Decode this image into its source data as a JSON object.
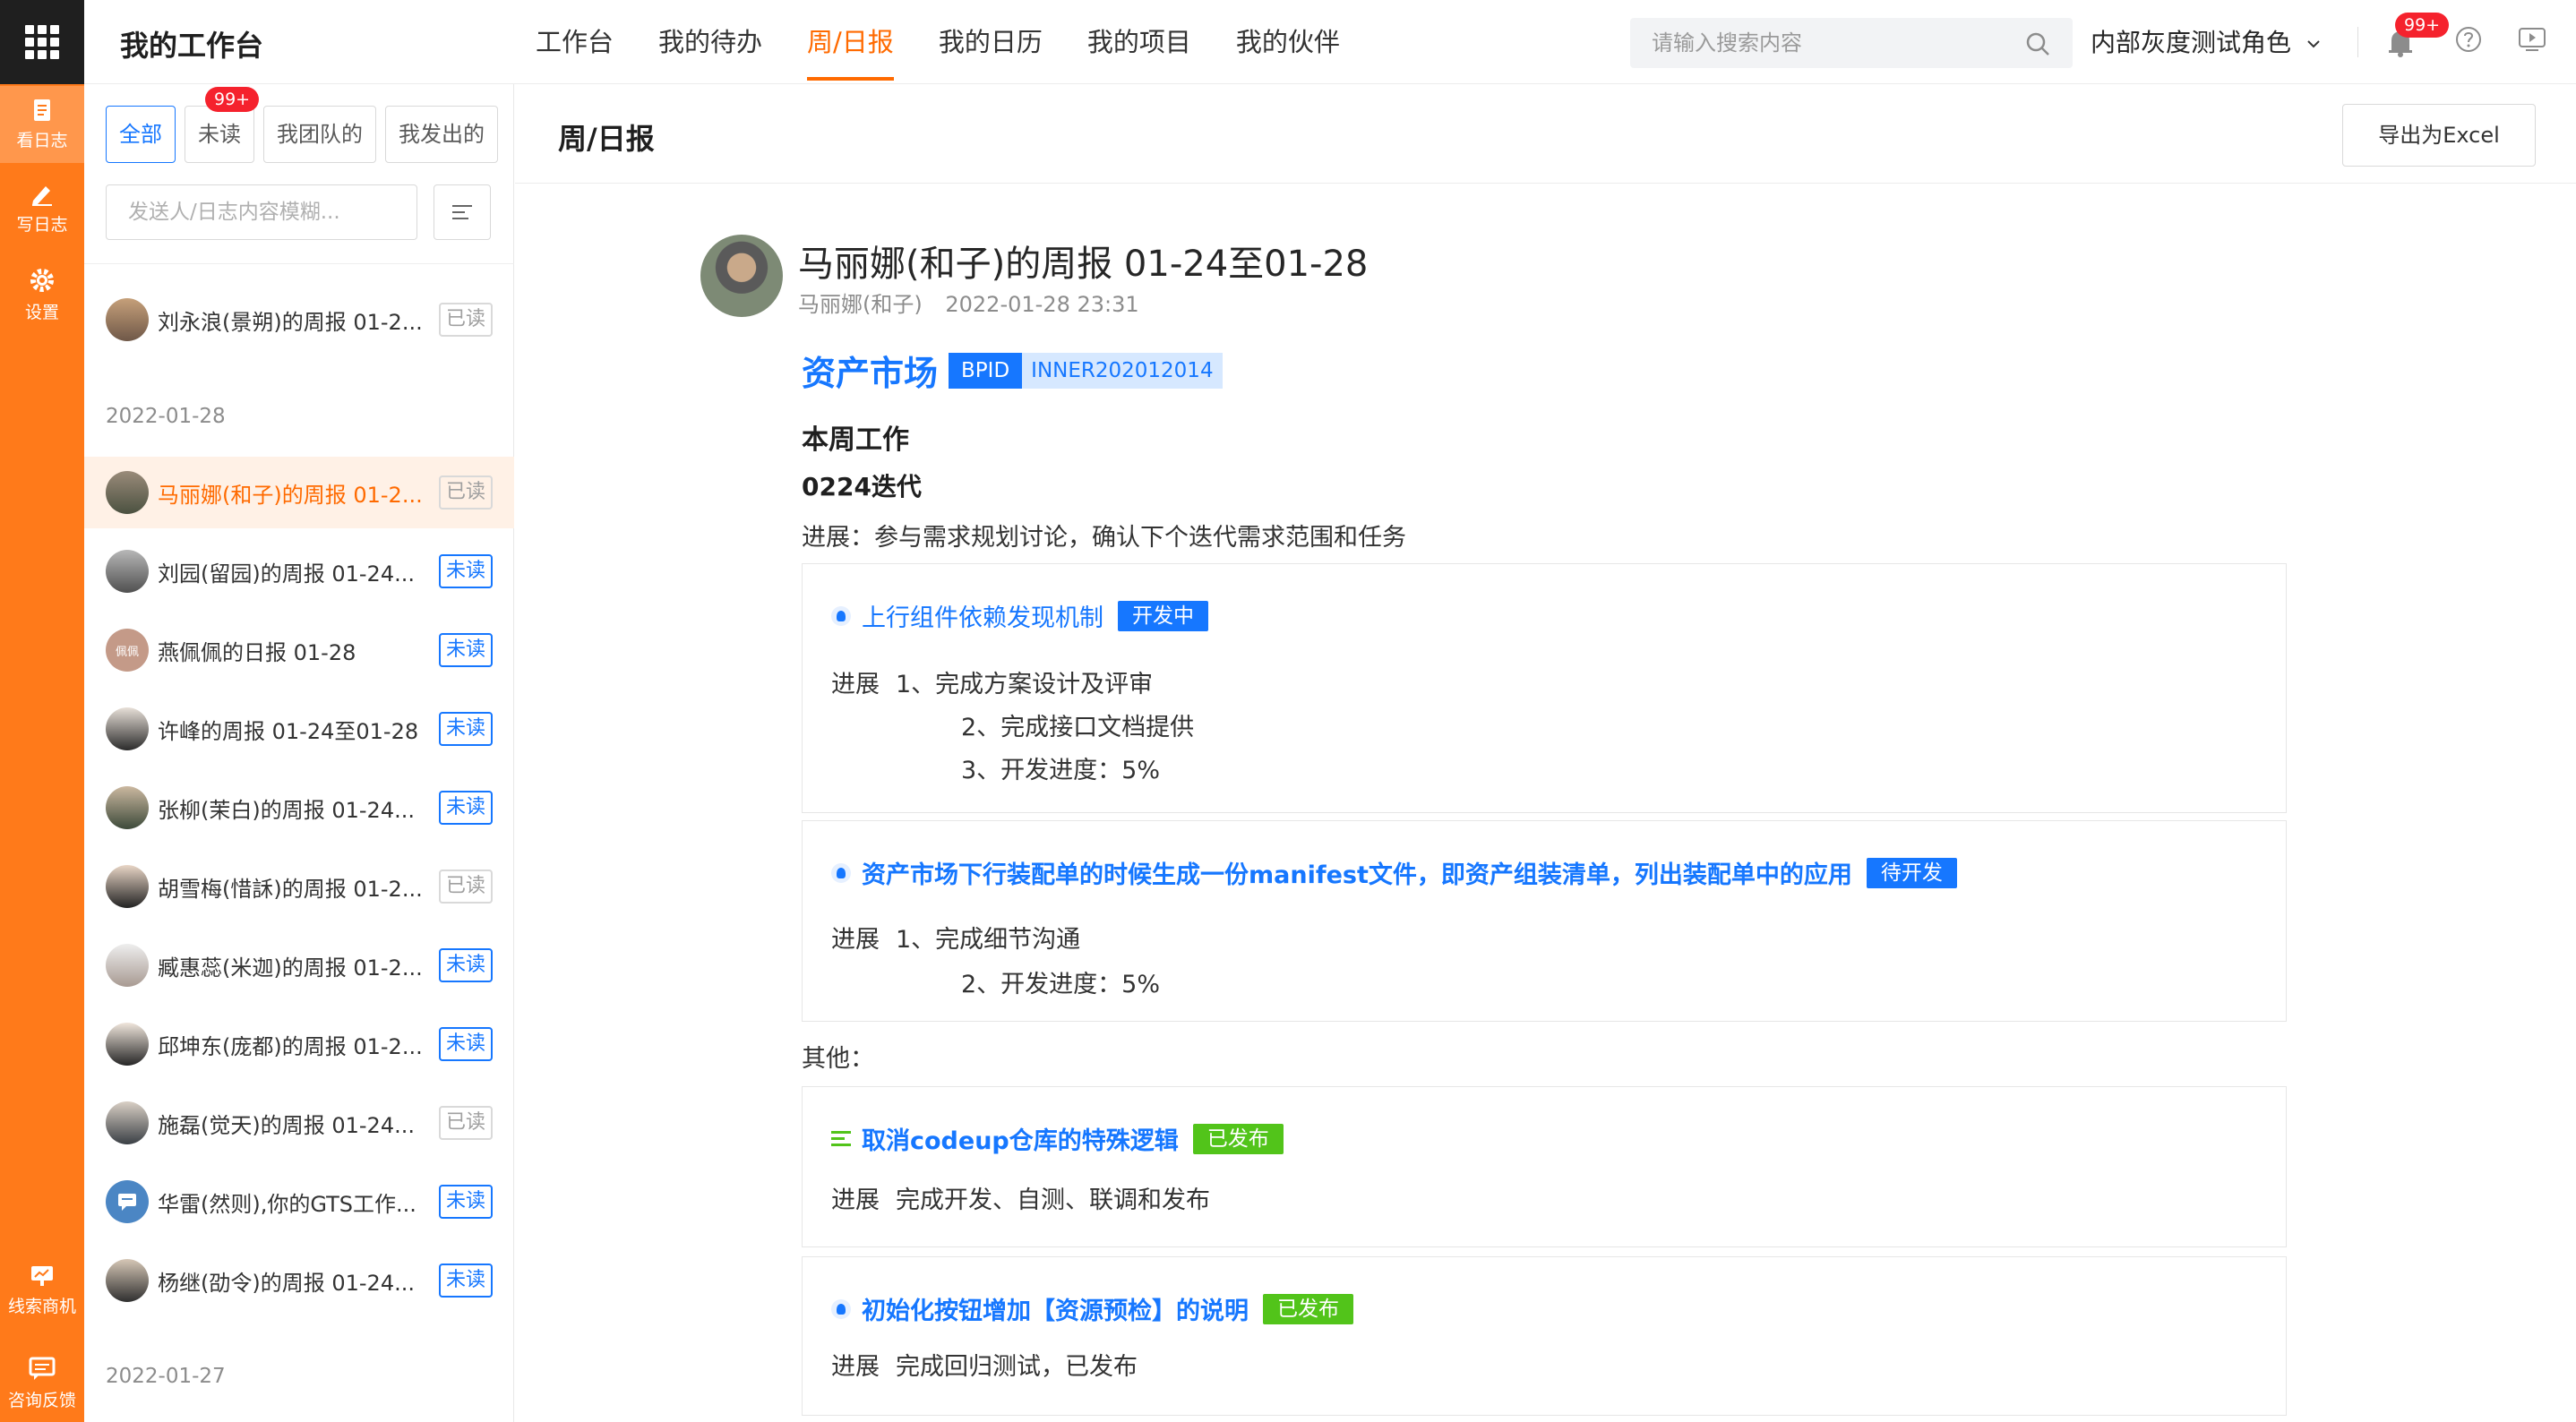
{
  "rail": {
    "items": [
      {
        "label": "看日志",
        "icon": "document-icon"
      },
      {
        "label": "写日志",
        "icon": "pencil-icon"
      },
      {
        "label": "设置",
        "icon": "gear-icon"
      },
      {
        "label": "线索商机",
        "icon": "presentation-icon"
      },
      {
        "label": "咨询反馈",
        "icon": "feedback-icon"
      }
    ]
  },
  "header": {
    "title": "我的工作台",
    "nav": [
      "工作台",
      "我的待办",
      "周/日报",
      "我的日历",
      "我的项目",
      "我的伙伴"
    ],
    "active_nav": "周/日报",
    "search_placeholder": "请输入搜索内容",
    "role": "内部灰度测试角色",
    "notification_badge": "99+"
  },
  "list": {
    "filters": [
      "全部",
      "未读",
      "我团队的",
      "我发出的"
    ],
    "unread_badge": "99+",
    "search_placeholder": "发送人/日志内容模糊...",
    "items_top": [
      {
        "name": "刘永浪(景朔)的周报 01-2...",
        "read": "已读"
      }
    ],
    "date1": "2022-01-28",
    "items": [
      {
        "name": "马丽娜(和子)的周报 01-2...",
        "read": "已读"
      },
      {
        "name": "刘园(留园)的周报 01-24...",
        "read": "未读"
      },
      {
        "name": "燕佩佩的日报 01-28",
        "read": "未读",
        "avatar_text": "佩佩"
      },
      {
        "name": "许峰的周报 01-24至01-28",
        "read": "未读"
      },
      {
        "name": "张柳(茉白)的周报 01-24...",
        "read": "未读"
      },
      {
        "name": "胡雪梅(惜訸)的周报 01-2...",
        "read": "已读"
      },
      {
        "name": "臧惠蕊(米迦)的周报 01-2...",
        "read": "未读"
      },
      {
        "name": "邱坤东(庞都)的周报 01-2...",
        "read": "未读"
      },
      {
        "name": "施磊(觉天)的周报 01-24...",
        "read": "已读"
      },
      {
        "name": "华雷(然则),你的GTS工作...",
        "read": "未读"
      },
      {
        "name": "杨继(劭令)的周报 01-24...",
        "read": "未读"
      }
    ],
    "date2": "2022-01-27"
  },
  "content": {
    "title": "周/日报",
    "export_label": "导出为Excel",
    "report": {
      "title": "马丽娜(和子)的周报 01-24至01-28",
      "author": "马丽娜(和子)",
      "time": "2022-01-28 23:31",
      "project": "资产市场",
      "bpid_label": "BPID",
      "bpid_value": "INNER202012014",
      "section": "本周工作",
      "iteration": "0224迭代",
      "progress": "进展：参与需求规划讨论，确认下个迭代需求范围和任务",
      "cards": [
        {
          "title": "上行组件依赖发现机制",
          "status": "开发中",
          "progress_label": "进展",
          "lines": [
            "1、完成方案设计及评审",
            "2、完成接口文档提供",
            "3、开发进度：5%"
          ]
        },
        {
          "title": "资产市场下行装配单的时候生成一份manifest文件，即资产组装清单，列出装配单中的应用",
          "status": "待开发",
          "progress_label": "进展",
          "lines": [
            "1、完成细节沟通",
            "2、开发进度：5%"
          ]
        }
      ],
      "other_label": "其他：",
      "other_cards": [
        {
          "title": "取消codeup仓库的特殊逻辑",
          "status": "已发布",
          "progress_label": "进展",
          "lines": [
            "完成开发、自测、联调和发布"
          ]
        },
        {
          "title": "初始化按钮增加【资源预检】的说明",
          "status": "已发布",
          "progress_label": "进展",
          "lines": [
            "完成回归测试，已发布"
          ]
        }
      ]
    }
  },
  "colors": {
    "accent": "#ff6a00",
    "rail": "#ff7a1a",
    "link": "#1677ff",
    "green": "#52c41a"
  }
}
